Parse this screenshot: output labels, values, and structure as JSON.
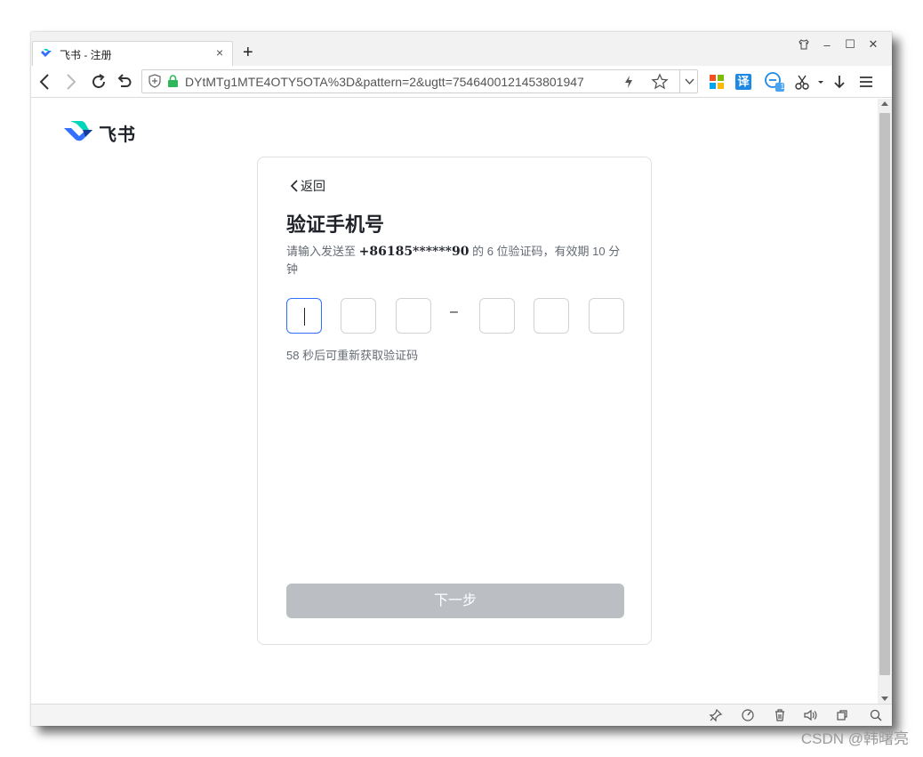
{
  "browser": {
    "tab_title": "飞书 - 注册",
    "tab_close": "×",
    "new_tab": "+",
    "address_url": "​DYtMTg1MTE4OTY5OTA%3D&pattern=2&ugtt=7546400121453801947",
    "window_controls": {
      "skin": "👕",
      "minimize": "–",
      "maximize": "☐",
      "close": "✕"
    },
    "nav": {
      "back": "‹",
      "forward": "›",
      "reload": "↻",
      "undo": "↺"
    },
    "translate_label": "译",
    "badge_count": "1"
  },
  "page": {
    "logo_text": "飞书",
    "back_label": "返回",
    "title": "验证手机号",
    "desc_prefix": "请输入发送至 ",
    "phone": "+86185******90",
    "desc_suffix": " 的 6 位验证码，有效期 10 分钟",
    "code_digits": [
      "",
      "",
      "",
      "",
      "",
      ""
    ],
    "separator": "–",
    "resend_text": "58 秒后可重新获取验证码",
    "next_button": "下一步"
  },
  "watermark": "CSDN @韩曙亮",
  "colors": {
    "brand_blue": "#3370ff",
    "button_disabled": "#bbbfc4",
    "text_primary": "#1f2329",
    "text_secondary": "#646a73"
  }
}
